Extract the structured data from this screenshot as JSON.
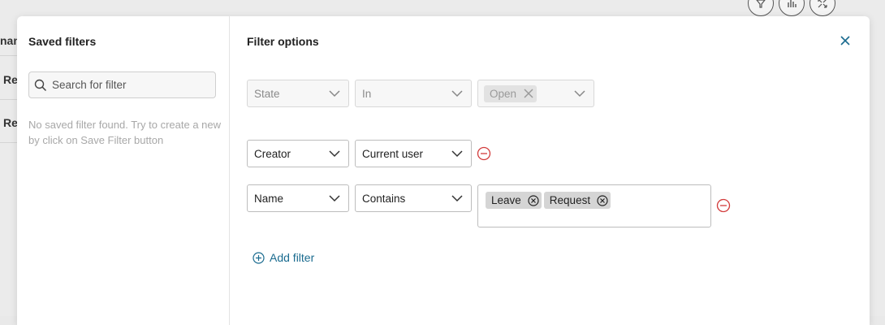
{
  "background": {
    "rows": [
      "nam",
      "Re",
      "Re"
    ]
  },
  "saved_filters": {
    "title": "Saved filters",
    "search_placeholder": "Search for filter",
    "empty_message": "No saved filter found. Try to create a new by click on Save Filter button"
  },
  "filter_options": {
    "title": "Filter options",
    "rows": [
      {
        "field": "State",
        "operator": "In",
        "values": [
          "Open"
        ],
        "disabled": true
      },
      {
        "field": "Creator",
        "operator": "Current user",
        "values": []
      },
      {
        "field": "Name",
        "operator": "Contains",
        "values": [
          "Leave",
          "Request"
        ]
      }
    ],
    "add_filter_label": "Add filter"
  },
  "colors": {
    "accent": "#1a6b8f",
    "remove": "#d23b3b"
  },
  "icons": {
    "search": "search-icon",
    "close": "close-icon",
    "chevron": "chevron-down-icon",
    "remove": "minus-circle-icon",
    "chip_remove": "x-circle-icon",
    "add": "plus-circle-icon"
  }
}
